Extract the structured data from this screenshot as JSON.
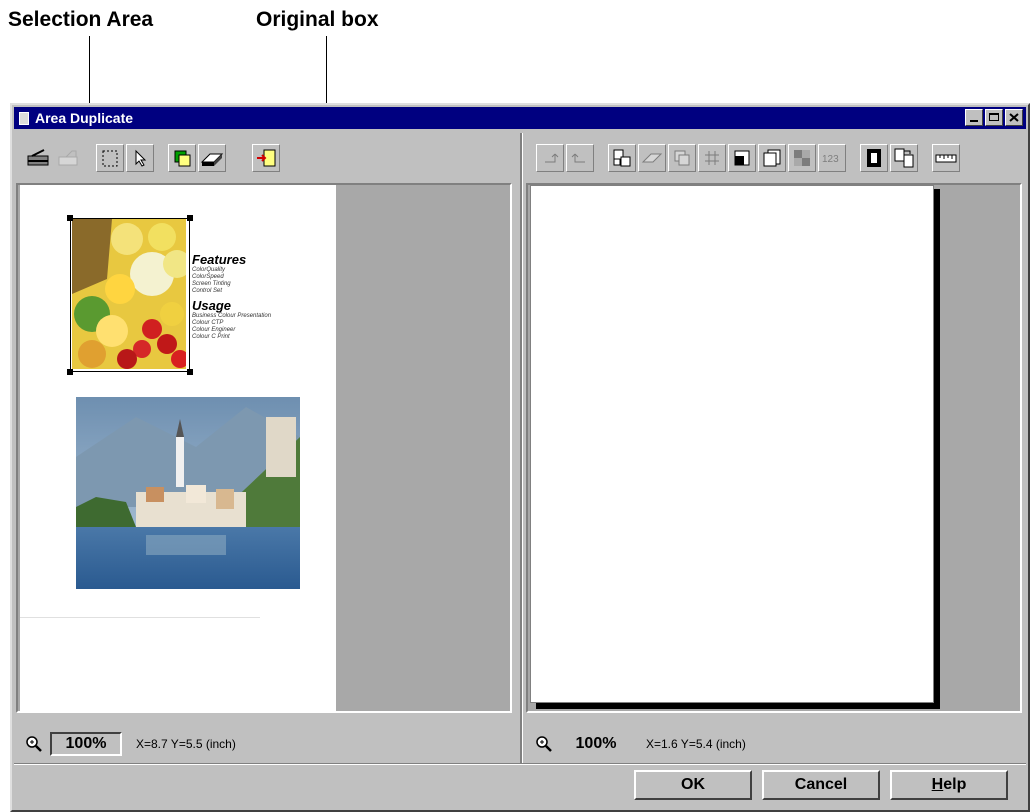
{
  "callouts": {
    "selection_area": "Selection Area",
    "original_box": "Original box"
  },
  "window": {
    "title": "Area Duplicate"
  },
  "left_pane": {
    "doc": {
      "heading1": "Features",
      "features": [
        "ColorQuality",
        "ColorSpeed",
        "Screen Tinting",
        "Control Set"
      ],
      "heading2": "Usage",
      "usage": [
        "Business Colour Presentation",
        "Colour CTP",
        "Colour Engineer",
        "Colour C Print"
      ]
    },
    "zoom": "100%",
    "coords": "X=8.7 Y=5.5 (inch)"
  },
  "right_pane": {
    "zoom": "100%",
    "coords": "X=1.6 Y=5.4 (inch)"
  },
  "buttons": {
    "ok": "OK",
    "cancel": "Cancel",
    "help_rest": "elp",
    "help_underlined": "H"
  },
  "icons": {
    "left_toolbar": [
      "scanner-icon",
      "image-icon",
      "rectangle-select-icon",
      "pointer-icon",
      "duplicate-icon",
      "eraser-icon",
      "import-icon"
    ],
    "right_toolbar": [
      "undo-icon",
      "redo-icon",
      "layout-icon",
      "erase-icon",
      "copy-icon",
      "grid-icon",
      "fill-icon",
      "frame-icon",
      "tile-icon",
      "number-icon",
      "contrast-icon",
      "swap-icon",
      "ruler-icon"
    ]
  }
}
